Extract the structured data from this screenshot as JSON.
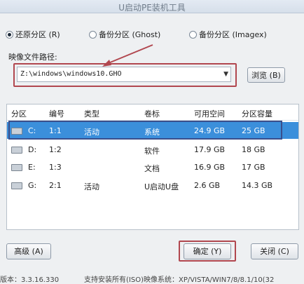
{
  "window": {
    "title": "U启动PE装机工具"
  },
  "modes": [
    {
      "label": "还原分区 (R)",
      "checked": true
    },
    {
      "label": "备份分区 (Ghost)",
      "checked": false
    },
    {
      "label": "备份分区 (Imagex)",
      "checked": false
    }
  ],
  "image_path": {
    "label": "映像文件路径:",
    "value": "Z:\\windows\\windows10.GHO",
    "browse_label": "浏览 (B)"
  },
  "table": {
    "columns": [
      "分区",
      "编号",
      "类型",
      "卷标",
      "可用空间",
      "分区容量"
    ],
    "rows": [
      {
        "drive": "C:",
        "number": "1:1",
        "type": "活动",
        "volume": "系统",
        "free": "24.9 GB",
        "size": "25 GB",
        "selected": true
      },
      {
        "drive": "D:",
        "number": "1:2",
        "type": "",
        "volume": "软件",
        "free": "17.9 GB",
        "size": "18 GB",
        "selected": false
      },
      {
        "drive": "E:",
        "number": "1:3",
        "type": "",
        "volume": "文档",
        "free": "16.9 GB",
        "size": "17 GB",
        "selected": false
      },
      {
        "drive": "G:",
        "number": "2:1",
        "type": "活动",
        "volume": "U启动U盘",
        "free": "2.6 GB",
        "size": "14.3 GB",
        "selected": false
      }
    ]
  },
  "buttons": {
    "advanced": "高级 (A)",
    "ok": "确定 (Y)",
    "close": "关闭 (C)"
  },
  "footer": {
    "version": "版本：3.3.16.330",
    "support": "支持安装所有(ISO)映像系统：XP/VISTA/WIN7/8/8.1/10(32"
  }
}
